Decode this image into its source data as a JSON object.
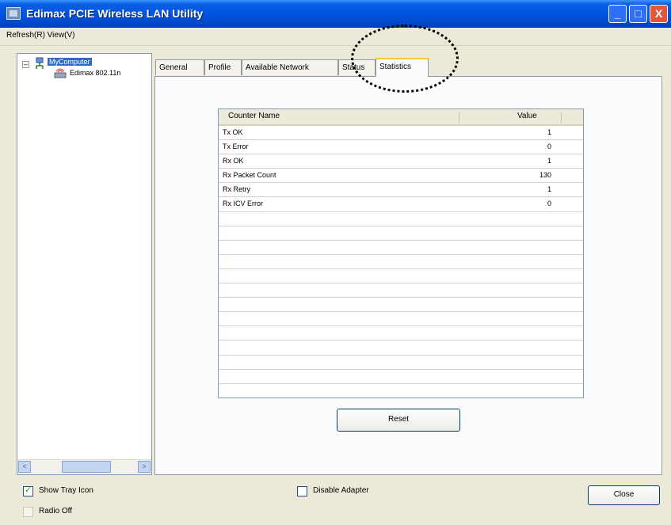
{
  "window": {
    "title": "Edimax PCIE Wireless LAN Utility",
    "menu_label": "Refresh(R)   View(V)",
    "controls": {
      "minimize": "_",
      "maximize": "□",
      "close": "X"
    }
  },
  "tree": {
    "expander": "–",
    "nodes": [
      {
        "label": "MyComputer"
      },
      {
        "label": "Edimax 802.11n"
      }
    ],
    "scroll_left": "<",
    "scroll_right": ">"
  },
  "tabs": [
    {
      "label": "General"
    },
    {
      "label": "Profile"
    },
    {
      "label": "Available Network"
    },
    {
      "label": "Status"
    },
    {
      "label": "Statistics"
    }
  ],
  "active_tab": "Statistics",
  "statistics": {
    "headers": {
      "name": "Counter Name",
      "value": "Value"
    },
    "rows": [
      {
        "name": "Tx OK",
        "value": "1"
      },
      {
        "name": "Tx Error",
        "value": "0"
      },
      {
        "name": "Rx OK",
        "value": "1"
      },
      {
        "name": "Rx Packet Count",
        "value": "130"
      },
      {
        "name": "Rx Retry",
        "value": "1"
      },
      {
        "name": "Rx ICV Error",
        "value": "0"
      },
      {
        "name": "",
        "value": ""
      },
      {
        "name": "",
        "value": ""
      },
      {
        "name": "",
        "value": ""
      },
      {
        "name": "",
        "value": ""
      },
      {
        "name": "",
        "value": ""
      },
      {
        "name": "",
        "value": ""
      },
      {
        "name": "",
        "value": ""
      },
      {
        "name": "",
        "value": ""
      },
      {
        "name": "",
        "value": ""
      },
      {
        "name": "",
        "value": ""
      },
      {
        "name": "",
        "value": ""
      },
      {
        "name": "",
        "value": ""
      },
      {
        "name": "",
        "value": ""
      }
    ],
    "reset_label": "Reset"
  },
  "footer": {
    "show_tray_icon": {
      "label": "Show Tray Icon",
      "checked": true
    },
    "radio_off": {
      "label": "Radio Off",
      "checked": false
    },
    "disable_adapter": {
      "label": "Disable Adapter",
      "checked": false
    },
    "close_label": "Close"
  },
  "colors": {
    "titlebar": "#0054e3",
    "active_tab_accent": "#ffc83c",
    "tree_selection": "#316ac5"
  }
}
